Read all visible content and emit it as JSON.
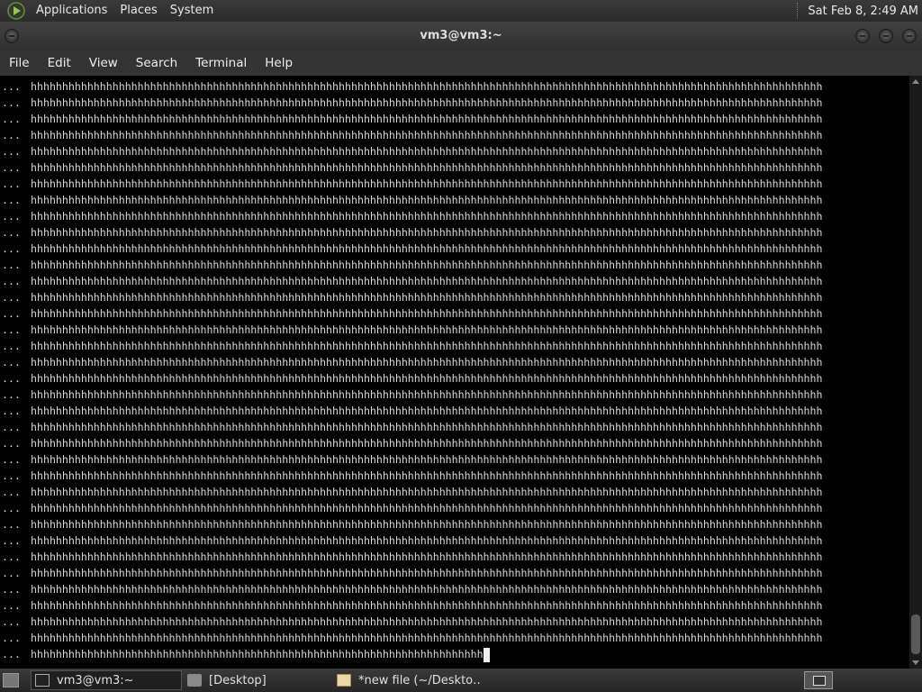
{
  "top_panel": {
    "menus": [
      "Applications",
      "Places",
      "System"
    ],
    "clock": "Sat Feb  8,  2:49 AM"
  },
  "window": {
    "title": "vm3@vm3:~"
  },
  "menubar": {
    "items": [
      "File",
      "Edit",
      "View",
      "Search",
      "Terminal",
      "Help"
    ]
  },
  "terminal": {
    "prompt": "...",
    "full_line": "hhhhhhhhhhhhhhhhhhhhhhhhhhhhhhhhhhhhhhhhhhhhhhhhhhhhhhhhhhhhhhhhhhhhhhhhhhhhhhhhhhhhhhhhhhhhhhhhhhhhhhhhhhhhhhhhhhhhhhhhhhhhhh",
    "full_line_count": 35,
    "last_line": "hhhhhhhhhhhhhhhhhhhhhhhhhhhhhhhhhhhhhhhhhhhhhhhhhhhhhhhhhhhhhhhhhhhhhhhh"
  },
  "taskbar": {
    "tasks": [
      {
        "label": "vm3@vm3:~",
        "icon": "terminal-icon",
        "active": true
      },
      {
        "label": "[Desktop]",
        "icon": "folder-icon",
        "active": false
      },
      {
        "label": "*new file (~/Deskto…",
        "icon": "text-editor-icon",
        "active": false
      }
    ]
  }
}
